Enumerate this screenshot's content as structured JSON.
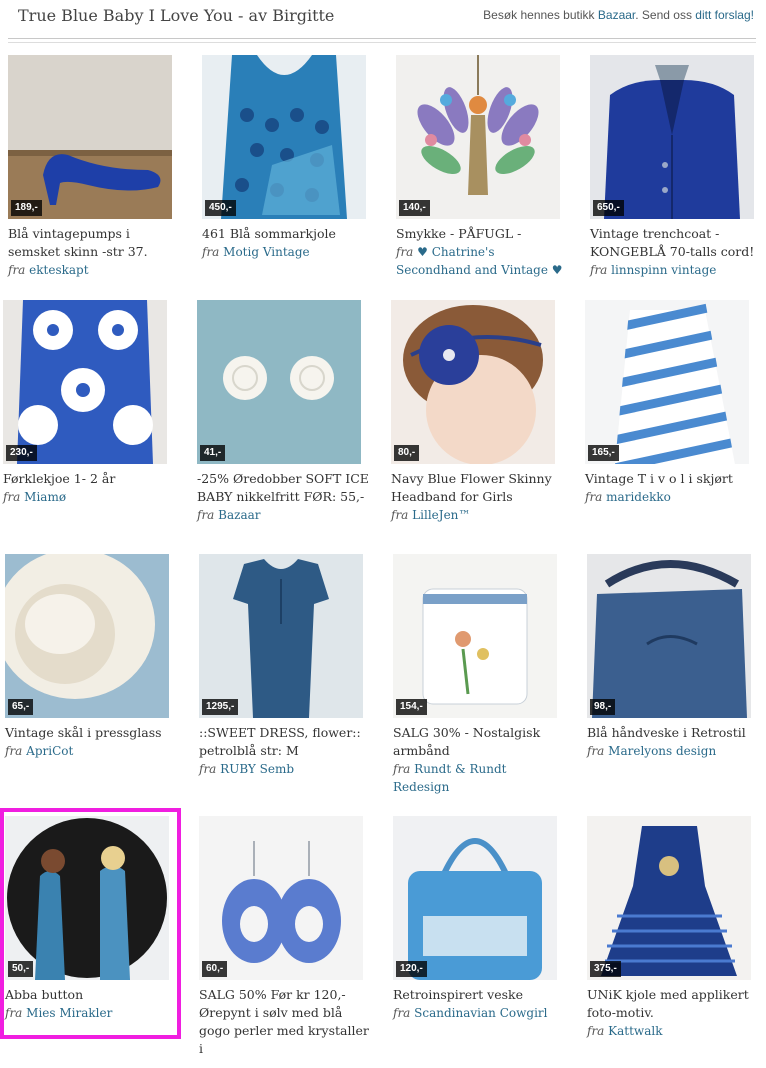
{
  "header": {
    "title": "True Blue Baby I Love You - av Birgitte",
    "visit_text": "Besøk hennes butikk",
    "shop_link": "Bazaar",
    "suggest_text": ". Send oss",
    "suggest_link": "ditt forslag!"
  },
  "fra_label": "fra",
  "items": [
    {
      "price": "189,-",
      "name": "Blå vintagepumps i semsket skinn -str 37.",
      "seller": "ekteskapt",
      "icon": "blue-pump-shoe"
    },
    {
      "price": "450,-",
      "name": "461 Blå sommarkjole",
      "seller": "Motig Vintage",
      "icon": "blue-pattern-dress"
    },
    {
      "price": "140,-",
      "name": "Smykke - PÅFUGL -",
      "seller": "♥ Chatrine's Secondhand and Vintage ♥",
      "icon": "peacock-pendant"
    },
    {
      "price": "650,-",
      "name": "Vintage trenchcoat - KONGEBLÅ 70-talls cord!",
      "seller": "linnspinn vintage",
      "icon": "blue-coat"
    },
    {
      "price": "230,-",
      "name": "Førklekjoe 1- 2 år",
      "seller": "Miamø",
      "icon": "flower-pinafore"
    },
    {
      "price": "41,-",
      "name": "-25% Øredobber SOFT ICE BABY nikkelfritt FØR: 55,-",
      "seller": "Bazaar",
      "icon": "white-earrings"
    },
    {
      "price": "80,-",
      "name": "Navy Blue Flower Skinny Headband for Girls",
      "seller": "LilleJen™",
      "icon": "baby-headband"
    },
    {
      "price": "165,-",
      "name": "Vintage T i v o l i skjørt",
      "seller": "maridekko",
      "icon": "striped-skirt"
    },
    {
      "price": "65,-",
      "name": "Vintage skål i pressglass",
      "seller": "ApriCot",
      "icon": "glass-bowl"
    },
    {
      "price": "1295,-",
      "name": "::SWEET DRESS, flower:: petrolblå str: M",
      "seller": "RUBY Semb",
      "icon": "petrol-dress"
    },
    {
      "price": "154,-",
      "name": "SALG 30% - Nostalgisk armbånd",
      "seller": "Rundt & Rundt Redesign",
      "icon": "cross-stitch-cuff"
    },
    {
      "price": "98,-",
      "name": "Blå håndveske i Retrostil",
      "seller": "Marelyons design",
      "icon": "blue-handbag"
    },
    {
      "price": "50,-",
      "name": "Abba button",
      "seller": "Mies Mirakler",
      "icon": "abba-button"
    },
    {
      "price": "60,-",
      "name": "SALG 50% Før kr 120,-Ørepynt i sølv med blå gogo perler med krystaller i",
      "seller": "",
      "icon": "blue-hoop-earrings"
    },
    {
      "price": "120,-",
      "name": "Retroinspirert veske",
      "seller": "Scandinavian Cowgirl",
      "icon": "shady-oaks-bag"
    },
    {
      "price": "375,-",
      "name": "UNiK kjole med applikert foto-motiv.",
      "seller": "Kattwalk",
      "icon": "kids-dress"
    }
  ]
}
